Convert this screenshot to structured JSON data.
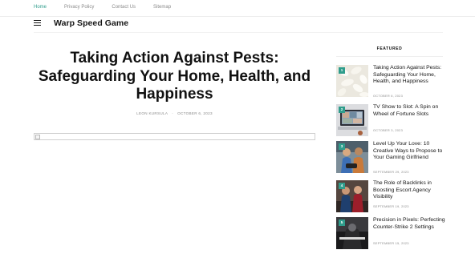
{
  "top_nav": [
    "Home",
    "Privacy Policy",
    "Contact Us",
    "Sitemap"
  ],
  "site": {
    "title": "Warp Speed Game",
    "menu_icon": "hamburger-icon"
  },
  "article": {
    "title": "Taking Action Against Pests: Safeguarding Your Home, Health, and Happiness",
    "author": "LEON KURSULA",
    "date": "OCTOBER 6, 2023",
    "hero_image_icon": "broken-image-icon"
  },
  "sidebar": {
    "heading": "FEATURED",
    "items": [
      {
        "number": "1",
        "title": "Taking Action Against Pests: Safeguarding Your Home, Health, and Happiness",
        "date": "OCTOBER 6, 2023"
      },
      {
        "number": "2",
        "title": "TV Show to Slot: A Spin on Wheel of Fortune Slots",
        "date": "OCTOBER 3, 2023"
      },
      {
        "number": "3",
        "title": "Level Up Your Love: 10 Creative Ways to Propose to Your Gaming Girlfriend",
        "date": "SEPTEMBER 29, 2023"
      },
      {
        "number": "4",
        "title": "The Role of Backlinks in Boosting Escort Agency Visibility",
        "date": "SEPTEMBER 19, 2023"
      },
      {
        "number": "5",
        "title": "Precision in Pixels: Perfecting Counter-Strike 2 Settings",
        "date": "SEPTEMBER 15, 2023"
      }
    ]
  },
  "colors": {
    "accent": "#2f9d8c",
    "text": "#111111",
    "muted": "#8a8a8a"
  }
}
